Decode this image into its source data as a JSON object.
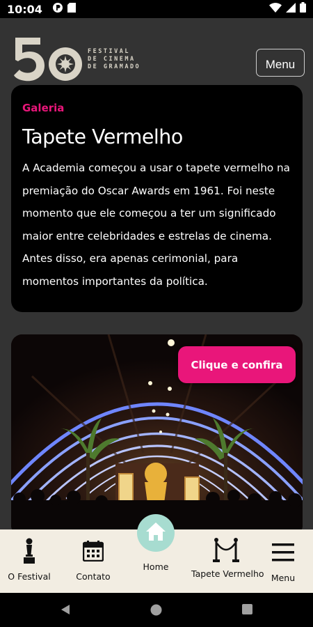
{
  "status_bar": {
    "time": "10:04"
  },
  "header": {
    "logo_number": "50",
    "logo_lines": [
      "FESTIVAL",
      "DE CINEMA",
      "DE GRAMADO"
    ],
    "menu_label": "Menu"
  },
  "card": {
    "eyebrow": "Galeria",
    "title": "Tapete Vermelho",
    "body": "A Academia começou a usar o tapete vermelho na premiação do Oscar Awards em 1961. Foi neste momento que ele começou a ter um significado maior entre celebridades e estrelas de cinema. Antes disso, era apenas cerimonial, para momentos importantes da política."
  },
  "photo": {
    "cta_label": "Clique e confira"
  },
  "bottom_nav": {
    "items": [
      {
        "label": "O Festival",
        "icon": "trophy-icon"
      },
      {
        "label": "Contato",
        "icon": "calendar-icon"
      },
      {
        "label": "Home",
        "icon": "home-icon"
      },
      {
        "label": "Tapete Vermelho",
        "icon": "stanchion-icon"
      },
      {
        "label": "Menu",
        "icon": "hamburger-icon"
      }
    ]
  },
  "colors": {
    "accent": "#e9167a",
    "background": "#333333",
    "nav_bg": "#f2ede2",
    "home_circle": "#a7dcd0"
  }
}
